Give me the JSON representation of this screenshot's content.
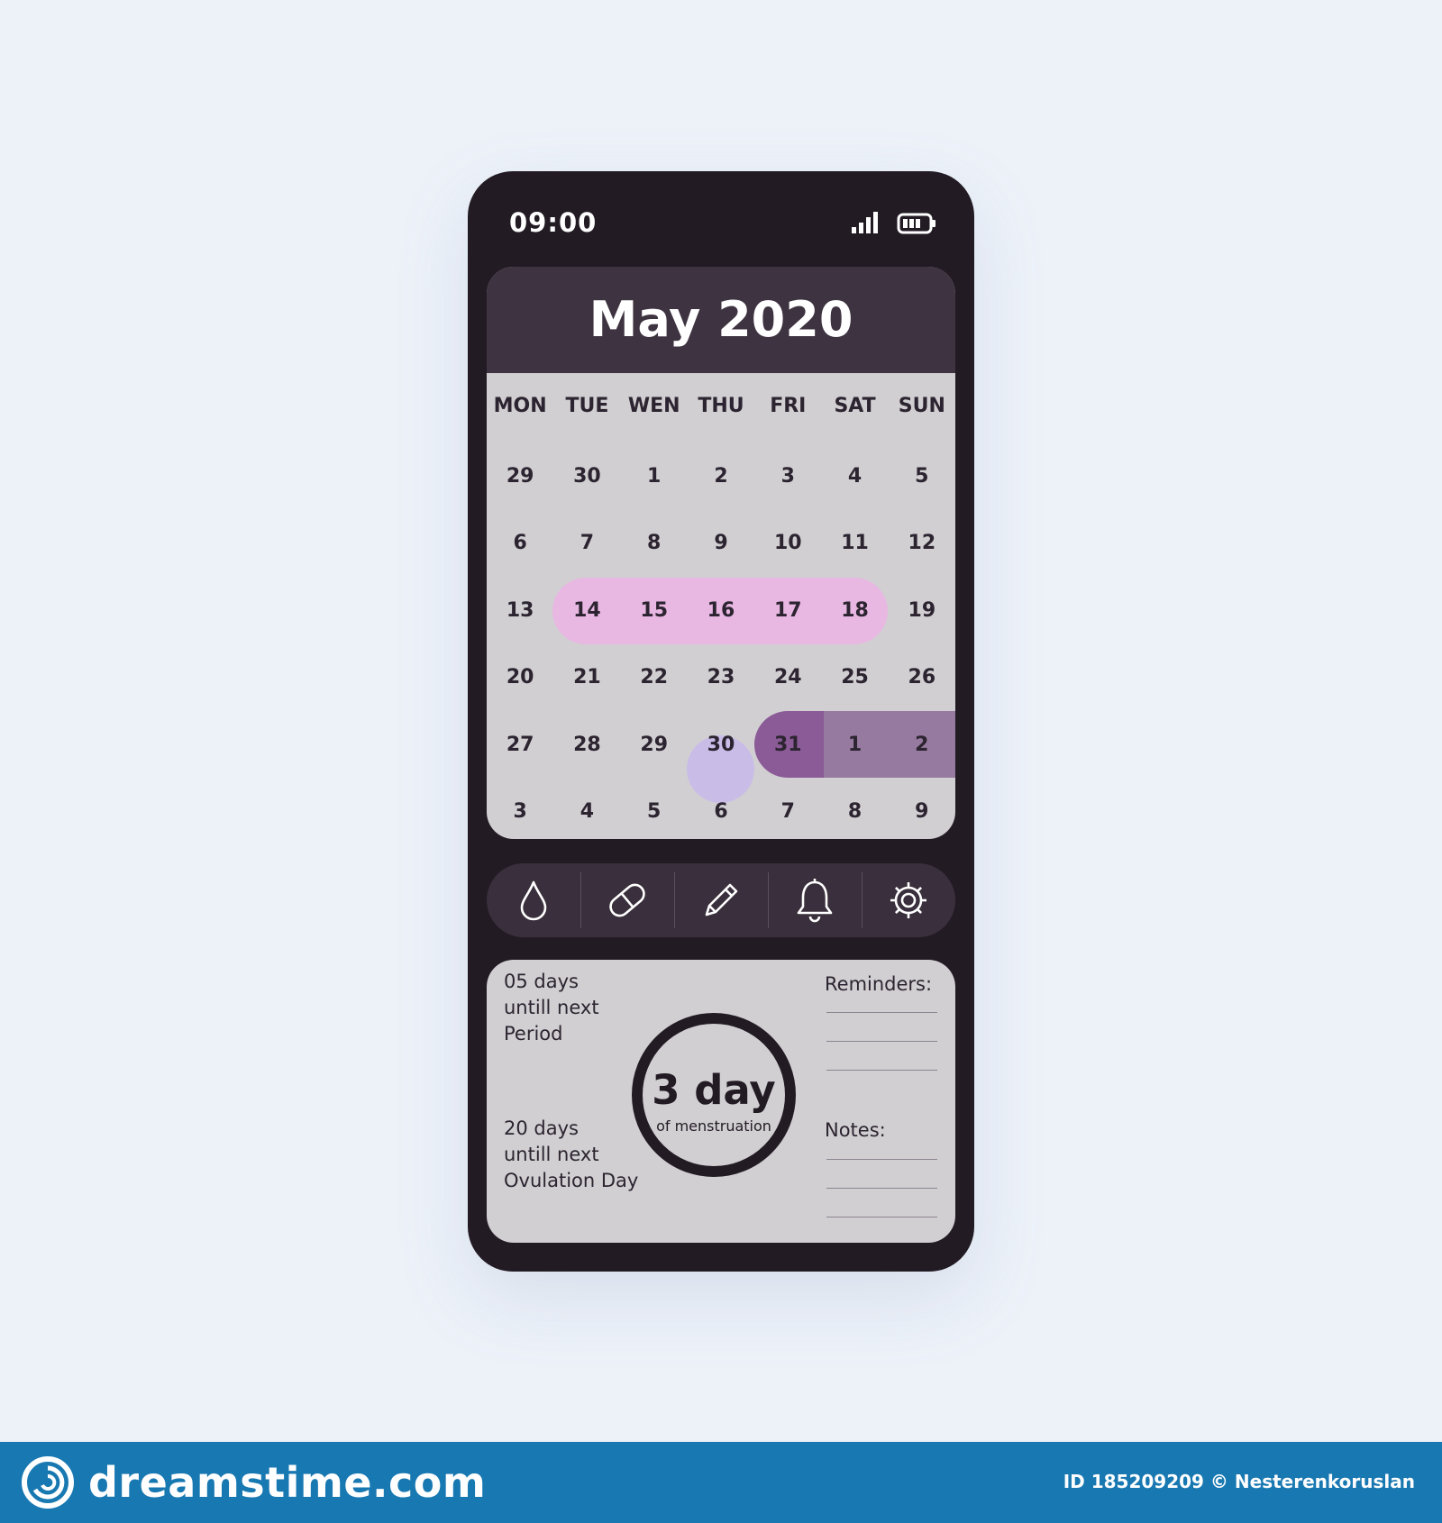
{
  "status_bar": {
    "time": "09:00"
  },
  "calendar": {
    "month_title": "May 2020",
    "weekdays": [
      "MON",
      "TUE",
      "WEN",
      "THU",
      "FRI",
      "SAT",
      "SUN"
    ],
    "weeks": [
      [
        "29",
        "30",
        "1",
        "2",
        "3",
        "4",
        "5"
      ],
      [
        "6",
        "7",
        "8",
        "9",
        "10",
        "11",
        "12"
      ],
      [
        "13",
        "14",
        "15",
        "16",
        "17",
        "18",
        "19"
      ],
      [
        "20",
        "21",
        "22",
        "23",
        "24",
        "25",
        "26"
      ],
      [
        "27",
        "28",
        "29",
        "30",
        "31",
        "1",
        "2"
      ],
      [
        "3",
        "4",
        "5",
        "6",
        "7",
        "8",
        "9"
      ]
    ],
    "colors": {
      "period": "#e8b8e2",
      "today": "#c9bde8",
      "next_period_start": "#8a5b97",
      "next_period": "#977a9f"
    }
  },
  "toolbar": {
    "icons": [
      "drop-icon",
      "pill-icon",
      "pencil-icon",
      "bell-icon",
      "gear-icon"
    ]
  },
  "info": {
    "next_period": {
      "line1": "05 days",
      "line2": "untill next",
      "line3": "Period"
    },
    "next_ovulation": {
      "line1": "20 days",
      "line2": "untill next",
      "line3": "Ovulation Day"
    },
    "current": {
      "value": "3 day",
      "caption": "of menstruation"
    },
    "reminders_label": "Reminders:",
    "notes_label": "Notes:"
  },
  "footer": {
    "brand": "dreamstime.com",
    "credit": "ID 185209209 © Nesterenkoruslan"
  }
}
